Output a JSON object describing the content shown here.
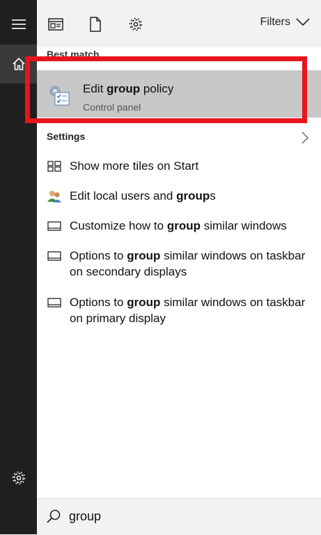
{
  "rail": {
    "menu_icon": "hamburger-icon",
    "home_icon": "home-icon",
    "settings_icon": "gear-icon"
  },
  "topbar": {
    "filters_label": "Filters"
  },
  "best_match": {
    "section_label": "Best match",
    "title_pre": "Edit ",
    "title_bold": "group",
    "title_post": " policy",
    "subtitle": "Control panel"
  },
  "settings": {
    "header": "Settings",
    "items": [
      {
        "pre": "Show more tiles on Start",
        "bold": "",
        "post": ""
      },
      {
        "pre": "Edit local users and ",
        "bold": "group",
        "post": "s"
      },
      {
        "pre": "Customize how to ",
        "bold": "group",
        "post": " similar windows"
      },
      {
        "pre": "Options to ",
        "bold": "group",
        "post": " similar windows on taskbar on secondary displays"
      },
      {
        "pre": "Options to ",
        "bold": "group",
        "post": " similar windows on taskbar on primary display"
      }
    ]
  },
  "search": {
    "value": "group"
  },
  "colors": {
    "highlight": "#e8141c",
    "rail": "#1f1f1f",
    "selection": "#c8c8c8"
  }
}
